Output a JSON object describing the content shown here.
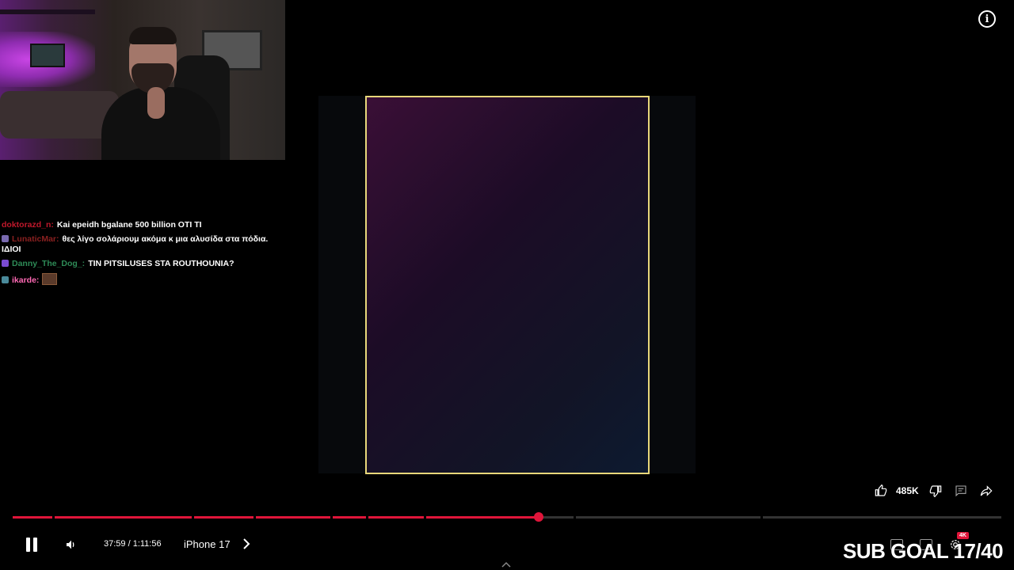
{
  "chat": {
    "messages": [
      {
        "user": "doktorazd_n:",
        "text": "Kai epeidh bgalane 500 billion OTI TI",
        "user_color": "#c0182b",
        "badge": false
      },
      {
        "user": "LunaticMar:",
        "text": "θες λίγο σολάριουμ ακόμα κ μια αλυσίδα στα πόδια. ΙΔΙΟΙ",
        "user_color": "#8a2020",
        "badge": true,
        "badge_color": "#7a6ab0"
      },
      {
        "user": "Danny_The_Dog_:",
        "text": "TIN PITSILUSES STA ROUTHOUNIA?",
        "user_color": "#2e8b57",
        "badge": true,
        "badge_color": "#7b4bd1"
      },
      {
        "user": "ikarde:",
        "text": "",
        "user_color": "#ff69b4",
        "badge": true,
        "badge_color": "#4a8a9a",
        "emote": true
      }
    ]
  },
  "actions": {
    "like_count": "485K"
  },
  "player": {
    "time": "37:59 / 1:11:56",
    "chapter": "iPhone 17",
    "progress_fraction": 0.528,
    "quality_badge": "4K"
  },
  "overlay": {
    "sub_goal": "SUB GOAL 17/40"
  },
  "colors": {
    "accent": "#e0153a",
    "frame_border": "#e8d77a"
  },
  "icons": [
    "info-icon",
    "like-icon",
    "dislike-icon",
    "comment-icon",
    "share-icon",
    "pause-icon",
    "volume-icon",
    "chevron-right-icon",
    "chevron-up-icon",
    "settings-icon",
    "subtitles-icon",
    "miniplayer-icon"
  ]
}
